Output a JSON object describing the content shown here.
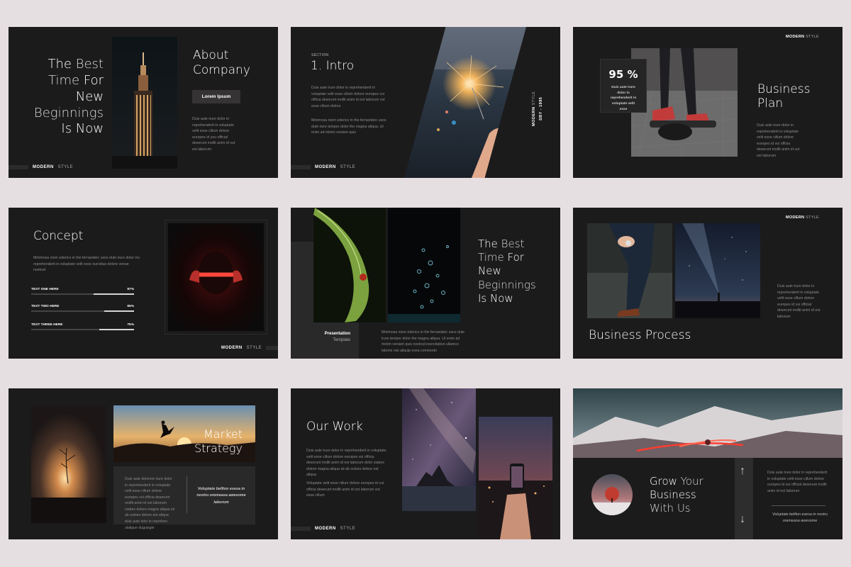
{
  "background_color": "#e6dfe2",
  "slides": {
    "s1": {
      "title_line1_a": "The",
      "title_line1_b": " Best",
      "title_line2_a": "Time",
      "title_line2_b": " For",
      "title_line3": "New",
      "title_line4": "Beginnings",
      "title_line5": "Is Now",
      "heading": "About Company",
      "heading_l1": "About",
      "heading_l2": "Company",
      "button": "Lorem Ipsum",
      "body": "Duis aute irure dolor in reprehenderit in voluptate velit esse cillum dolore europes id you official deserunt mollit anim id vut est laborum",
      "footer_bold": "MODERN",
      "footer_dim": "STYLE"
    },
    "s2": {
      "section_label": "SECTION",
      "title": "1. Intro",
      "body1": "Duis aute irure dolor in reprehenderit in voluptate velit esse cillum dolore europes vui officia deserunt mollit anim id est laborum vut esse cillum dolore",
      "body2": "Minimosa niom ederico in the fernandeic usos dute irure tempor dolor the magna aliqua. Ut enim ad minim veniam quis",
      "vertical_bold": "MODERN",
      "vertical_dim": "STYLE",
      "vertical_year": "SBY - 1995",
      "footer_bold": "MODERN",
      "footer_dim": "STYLE"
    },
    "s3": {
      "brand_bold": "MODERN",
      "brand_dim": "STYLE",
      "stat": "95 %",
      "stat_text": "Duis aute irure dolor in reprehenderit in voluptate velit esse",
      "title_l1": "Business",
      "title_l2": "Plan",
      "body": "Duis aute irure dolor in reprehenderit in voluptate velit esse cillum dolore europes id vui officia deserunt mollit anim id vut est laborum"
    },
    "s4": {
      "title": "Concept",
      "body": "Minimosa niom ederico in the fernandeic usos dute irure dolor ins reprehenderit in voluptate velit esse eurodius dolore venue nostrud",
      "bars": [
        {
          "label": "TEXT ONE HERE",
          "value": "87%",
          "fraction": 0.87
        },
        {
          "label": "TEXT TWO HERE",
          "value": "65%",
          "fraction": 0.65
        },
        {
          "label": "TEXT THREE HERE",
          "value": "75%",
          "fraction": 0.75
        }
      ],
      "footer_bold": "MODERN",
      "footer_dim": "STYLE"
    },
    "s5": {
      "title_line1_a": "The",
      "title_line1_b": " Best",
      "title_line2_a": "Time",
      "title_line2_b": " For",
      "title_line3": "New",
      "title_line4": "Beginnings",
      "title_line5": "Is Now",
      "label_bold": "Presentation",
      "label_dim": "Template",
      "body": "Minimosa niom ederico in the fernandeic usos dute irure tempor dolor the magna aliqua. Ut enim ad minim veniam quis nostrud exercitation ullamco laboris nisi aliquip exea commodo"
    },
    "s6": {
      "brand_bold": "MODERN",
      "brand_dim": "STYLE",
      "title": "Business Process",
      "body": "Duis aute irure dolor in reprehenderit in voluptate velit esse cillum dolore europes id vui official deserunt mollit anim id est laborum"
    },
    "s7": {
      "title_l1": "Market",
      "title_l2": "Strategy",
      "body": "Duis aute dolorem irure dolor in reprehenderit in voluptate velit esse cillum dolore europes vui officia deserunt mollit anim id est laborum siabes dolore magna aliqua sit ab soloes dolore est aliqua duis aute iolor in reprehen ulaligue duguisgle",
      "quote": "Voluptate bellton esesa in nostru oremeasa awesome laborum"
    },
    "s8": {
      "title": "Our Work",
      "body1": "Duis aute irure dolor in reprehenderit in voluptate velit esse cillum dolore europes vui officia deserunt mollit anim id est laborum dolor siabes dolore magna aliqua sit ab soloes dolore est aliqua",
      "body2": "Voluptate velit esse cillum dolore europes id vui officia deserunt mollit anim id est laborum vut esse cillum",
      "footer_bold": "MODERN",
      "footer_dim": "STYLE"
    },
    "s9": {
      "title_l1_a": "Grow",
      "title_l1_b": " Your",
      "title_l2": "Business",
      "title_l3": "With Us",
      "body": "Duis aute irure dolor in reprehenderit in voluptate velit esse cillum dolore europes id vui official deserunt mollit anim id est laborum",
      "quote": "Voluptate bellton esesa in nostru oremeasa  awesome",
      "arrow_up": "↑",
      "arrow_down": "↓"
    }
  }
}
